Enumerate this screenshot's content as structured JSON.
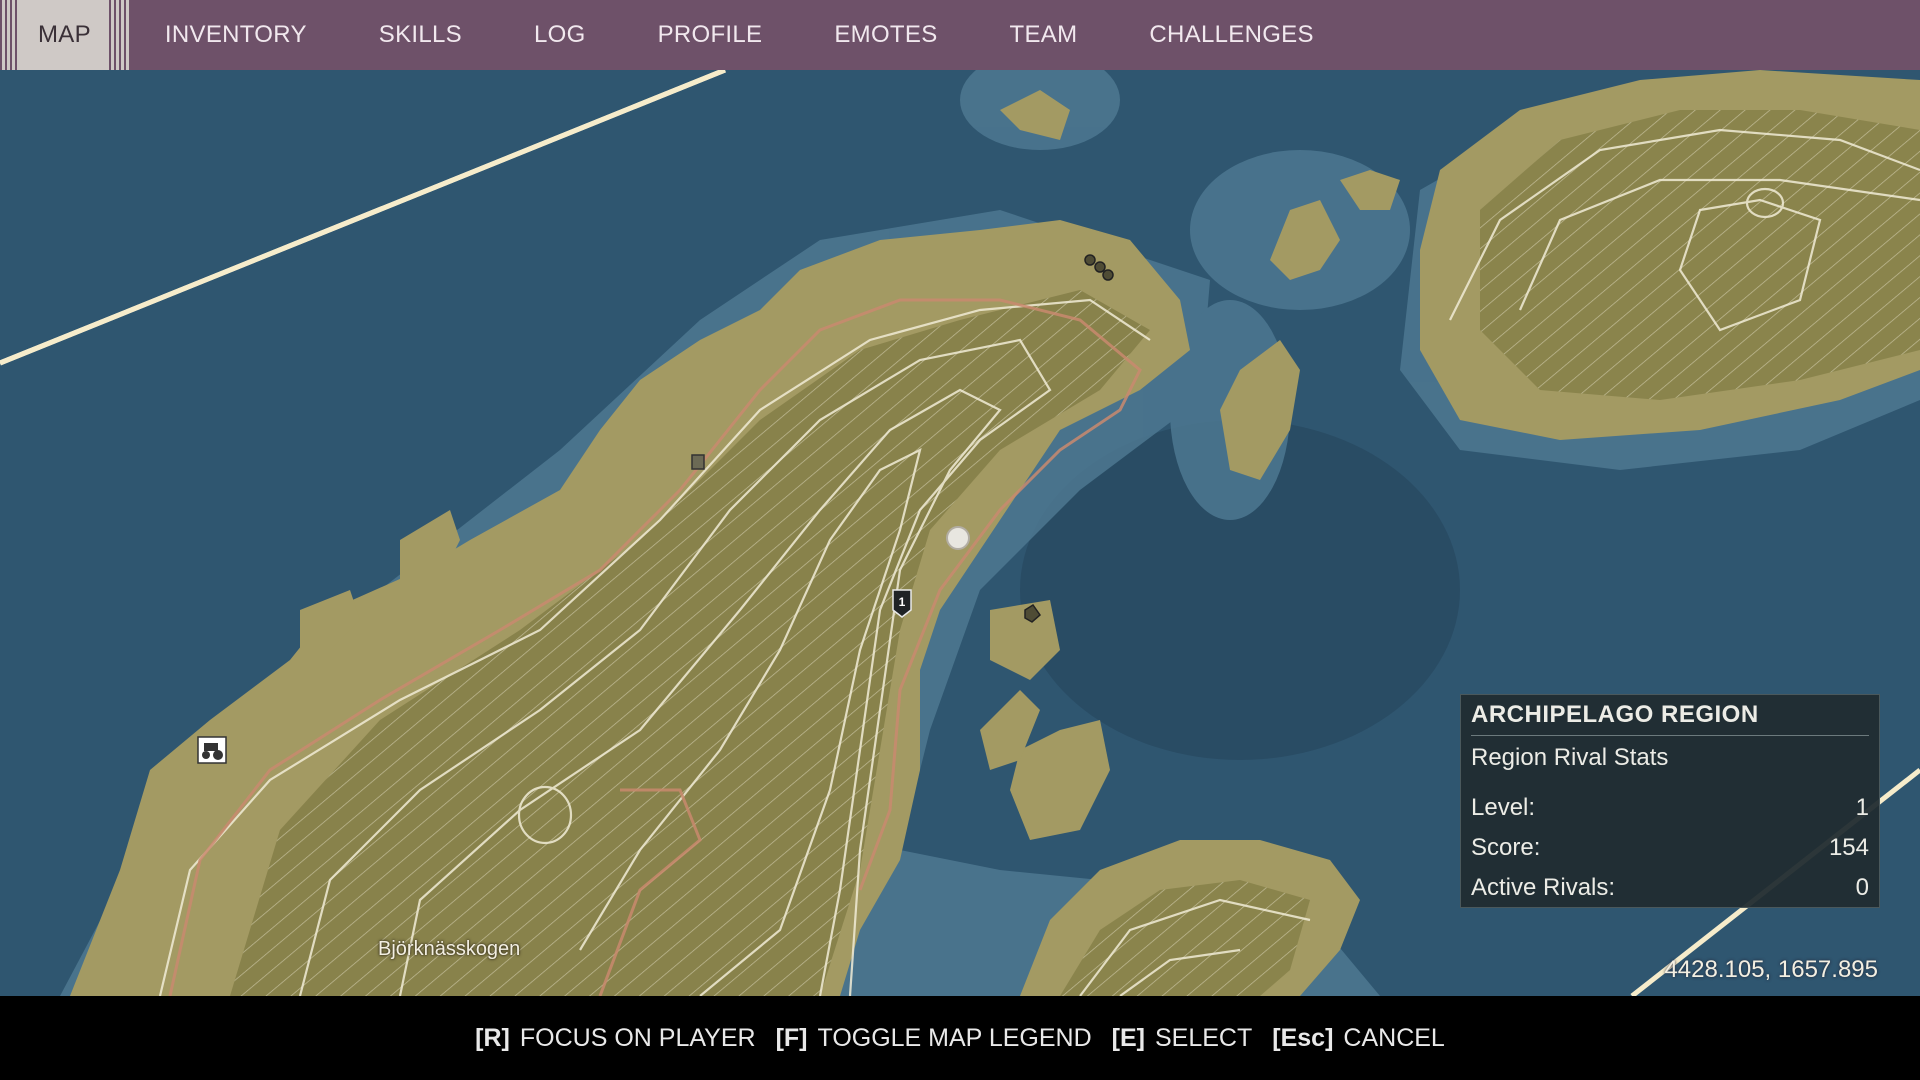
{
  "nav": {
    "tabs": [
      {
        "label": "MAP",
        "active": true
      },
      {
        "label": "INVENTORY"
      },
      {
        "label": "SKILLS"
      },
      {
        "label": "LOG"
      },
      {
        "label": "PROFILE"
      },
      {
        "label": "EMOTES"
      },
      {
        "label": "TEAM"
      },
      {
        "label": "CHALLENGES"
      }
    ]
  },
  "map": {
    "place_label": "Björknässkogen",
    "coordinates": "4428.105, 1657.895",
    "marker_number": "1",
    "colors": {
      "deep_water": "#2f5670",
      "shallow_water": "#4d7891",
      "land": "#a39a63",
      "highland": "#7f7a43",
      "road": "#c98a6e",
      "contour": "#f1ecd6",
      "boundary": "#f6eccb"
    }
  },
  "region_panel": {
    "title": "ARCHIPELAGO REGION",
    "subtitle": "Region Rival Stats",
    "stats": [
      {
        "label": "Level:",
        "value": "1"
      },
      {
        "label": "Score:",
        "value": "154"
      },
      {
        "label": "Active Rivals:",
        "value": "0"
      }
    ]
  },
  "controls": [
    {
      "key": "[R]",
      "label": "FOCUS ON PLAYER"
    },
    {
      "key": "[F]",
      "label": "TOGGLE MAP LEGEND"
    },
    {
      "key": "[E]",
      "label": "SELECT"
    },
    {
      "key": "[Esc]",
      "label": "CANCEL"
    }
  ]
}
